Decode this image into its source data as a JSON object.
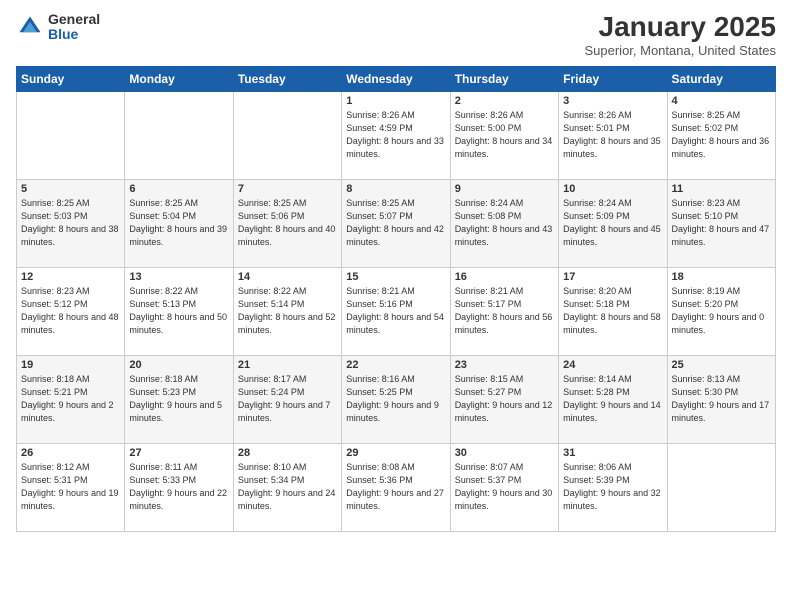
{
  "logo": {
    "general": "General",
    "blue": "Blue"
  },
  "header": {
    "month": "January 2025",
    "location": "Superior, Montana, United States"
  },
  "weekdays": [
    "Sunday",
    "Monday",
    "Tuesday",
    "Wednesday",
    "Thursday",
    "Friday",
    "Saturday"
  ],
  "weeks": [
    [
      {
        "day": "",
        "sunrise": "",
        "sunset": "",
        "daylight": ""
      },
      {
        "day": "",
        "sunrise": "",
        "sunset": "",
        "daylight": ""
      },
      {
        "day": "",
        "sunrise": "",
        "sunset": "",
        "daylight": ""
      },
      {
        "day": "1",
        "sunrise": "Sunrise: 8:26 AM",
        "sunset": "Sunset: 4:59 PM",
        "daylight": "Daylight: 8 hours and 33 minutes."
      },
      {
        "day": "2",
        "sunrise": "Sunrise: 8:26 AM",
        "sunset": "Sunset: 5:00 PM",
        "daylight": "Daylight: 8 hours and 34 minutes."
      },
      {
        "day": "3",
        "sunrise": "Sunrise: 8:26 AM",
        "sunset": "Sunset: 5:01 PM",
        "daylight": "Daylight: 8 hours and 35 minutes."
      },
      {
        "day": "4",
        "sunrise": "Sunrise: 8:25 AM",
        "sunset": "Sunset: 5:02 PM",
        "daylight": "Daylight: 8 hours and 36 minutes."
      }
    ],
    [
      {
        "day": "5",
        "sunrise": "Sunrise: 8:25 AM",
        "sunset": "Sunset: 5:03 PM",
        "daylight": "Daylight: 8 hours and 38 minutes."
      },
      {
        "day": "6",
        "sunrise": "Sunrise: 8:25 AM",
        "sunset": "Sunset: 5:04 PM",
        "daylight": "Daylight: 8 hours and 39 minutes."
      },
      {
        "day": "7",
        "sunrise": "Sunrise: 8:25 AM",
        "sunset": "Sunset: 5:06 PM",
        "daylight": "Daylight: 8 hours and 40 minutes."
      },
      {
        "day": "8",
        "sunrise": "Sunrise: 8:25 AM",
        "sunset": "Sunset: 5:07 PM",
        "daylight": "Daylight: 8 hours and 42 minutes."
      },
      {
        "day": "9",
        "sunrise": "Sunrise: 8:24 AM",
        "sunset": "Sunset: 5:08 PM",
        "daylight": "Daylight: 8 hours and 43 minutes."
      },
      {
        "day": "10",
        "sunrise": "Sunrise: 8:24 AM",
        "sunset": "Sunset: 5:09 PM",
        "daylight": "Daylight: 8 hours and 45 minutes."
      },
      {
        "day": "11",
        "sunrise": "Sunrise: 8:23 AM",
        "sunset": "Sunset: 5:10 PM",
        "daylight": "Daylight: 8 hours and 47 minutes."
      }
    ],
    [
      {
        "day": "12",
        "sunrise": "Sunrise: 8:23 AM",
        "sunset": "Sunset: 5:12 PM",
        "daylight": "Daylight: 8 hours and 48 minutes."
      },
      {
        "day": "13",
        "sunrise": "Sunrise: 8:22 AM",
        "sunset": "Sunset: 5:13 PM",
        "daylight": "Daylight: 8 hours and 50 minutes."
      },
      {
        "day": "14",
        "sunrise": "Sunrise: 8:22 AM",
        "sunset": "Sunset: 5:14 PM",
        "daylight": "Daylight: 8 hours and 52 minutes."
      },
      {
        "day": "15",
        "sunrise": "Sunrise: 8:21 AM",
        "sunset": "Sunset: 5:16 PM",
        "daylight": "Daylight: 8 hours and 54 minutes."
      },
      {
        "day": "16",
        "sunrise": "Sunrise: 8:21 AM",
        "sunset": "Sunset: 5:17 PM",
        "daylight": "Daylight: 8 hours and 56 minutes."
      },
      {
        "day": "17",
        "sunrise": "Sunrise: 8:20 AM",
        "sunset": "Sunset: 5:18 PM",
        "daylight": "Daylight: 8 hours and 58 minutes."
      },
      {
        "day": "18",
        "sunrise": "Sunrise: 8:19 AM",
        "sunset": "Sunset: 5:20 PM",
        "daylight": "Daylight: 9 hours and 0 minutes."
      }
    ],
    [
      {
        "day": "19",
        "sunrise": "Sunrise: 8:18 AM",
        "sunset": "Sunset: 5:21 PM",
        "daylight": "Daylight: 9 hours and 2 minutes."
      },
      {
        "day": "20",
        "sunrise": "Sunrise: 8:18 AM",
        "sunset": "Sunset: 5:23 PM",
        "daylight": "Daylight: 9 hours and 5 minutes."
      },
      {
        "day": "21",
        "sunrise": "Sunrise: 8:17 AM",
        "sunset": "Sunset: 5:24 PM",
        "daylight": "Daylight: 9 hours and 7 minutes."
      },
      {
        "day": "22",
        "sunrise": "Sunrise: 8:16 AM",
        "sunset": "Sunset: 5:25 PM",
        "daylight": "Daylight: 9 hours and 9 minutes."
      },
      {
        "day": "23",
        "sunrise": "Sunrise: 8:15 AM",
        "sunset": "Sunset: 5:27 PM",
        "daylight": "Daylight: 9 hours and 12 minutes."
      },
      {
        "day": "24",
        "sunrise": "Sunrise: 8:14 AM",
        "sunset": "Sunset: 5:28 PM",
        "daylight": "Daylight: 9 hours and 14 minutes."
      },
      {
        "day": "25",
        "sunrise": "Sunrise: 8:13 AM",
        "sunset": "Sunset: 5:30 PM",
        "daylight": "Daylight: 9 hours and 17 minutes."
      }
    ],
    [
      {
        "day": "26",
        "sunrise": "Sunrise: 8:12 AM",
        "sunset": "Sunset: 5:31 PM",
        "daylight": "Daylight: 9 hours and 19 minutes."
      },
      {
        "day": "27",
        "sunrise": "Sunrise: 8:11 AM",
        "sunset": "Sunset: 5:33 PM",
        "daylight": "Daylight: 9 hours and 22 minutes."
      },
      {
        "day": "28",
        "sunrise": "Sunrise: 8:10 AM",
        "sunset": "Sunset: 5:34 PM",
        "daylight": "Daylight: 9 hours and 24 minutes."
      },
      {
        "day": "29",
        "sunrise": "Sunrise: 8:08 AM",
        "sunset": "Sunset: 5:36 PM",
        "daylight": "Daylight: 9 hours and 27 minutes."
      },
      {
        "day": "30",
        "sunrise": "Sunrise: 8:07 AM",
        "sunset": "Sunset: 5:37 PM",
        "daylight": "Daylight: 9 hours and 30 minutes."
      },
      {
        "day": "31",
        "sunrise": "Sunrise: 8:06 AM",
        "sunset": "Sunset: 5:39 PM",
        "daylight": "Daylight: 9 hours and 32 minutes."
      },
      {
        "day": "",
        "sunrise": "",
        "sunset": "",
        "daylight": ""
      }
    ]
  ]
}
